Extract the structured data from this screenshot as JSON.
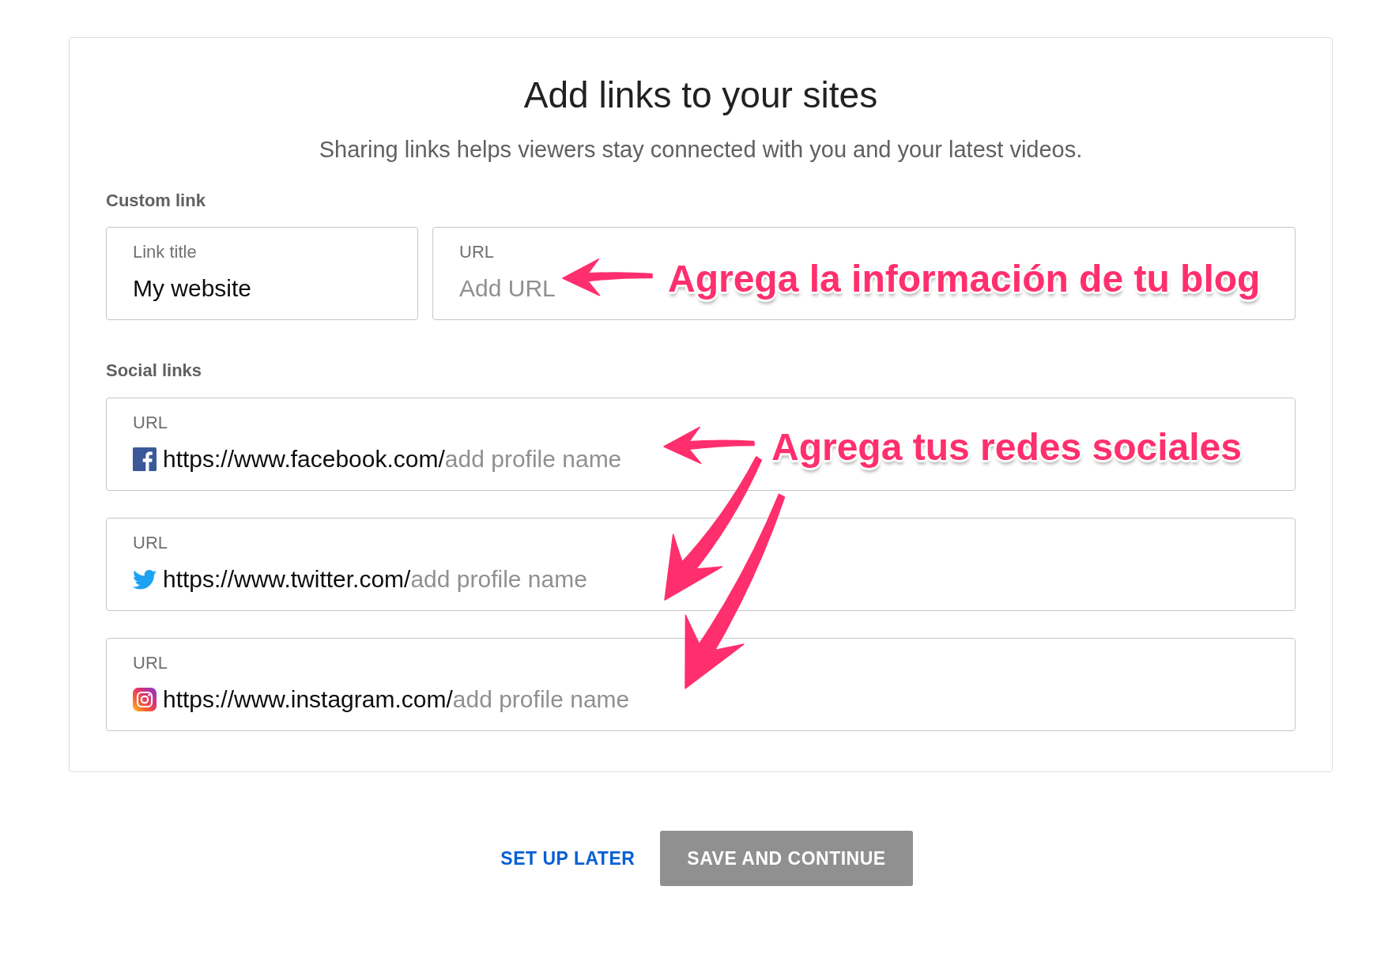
{
  "title": "Add links to your sites",
  "subtitle": "Sharing links helps viewers stay connected with you and your latest videos.",
  "custom_link": {
    "heading": "Custom link",
    "fields": [
      {
        "label": "Link title",
        "value": "My website"
      },
      {
        "label": "URL",
        "placeholder": "Add URL"
      }
    ]
  },
  "social_links": {
    "heading": "Social links",
    "fields": [
      {
        "label": "URL",
        "kind": "facebook",
        "prefix": "https://www.facebook.com/",
        "placeholder": "add profile name"
      },
      {
        "label": "URL",
        "kind": "twitter",
        "prefix": "https://www.twitter.com/",
        "placeholder": "add profile name"
      },
      {
        "label": "URL",
        "kind": "instagram",
        "prefix": "https://www.instagram.com/",
        "placeholder": "add profile name"
      }
    ]
  },
  "annotations": [
    {
      "text": "Agrega la información de tu blog"
    },
    {
      "text": "Agrega tus redes sociales"
    }
  ],
  "buttons": [
    {
      "label": "SET UP LATER",
      "kind": "text"
    },
    {
      "label": "SAVE AND CONTINUE",
      "kind": "primary",
      "disabled": true
    }
  ]
}
